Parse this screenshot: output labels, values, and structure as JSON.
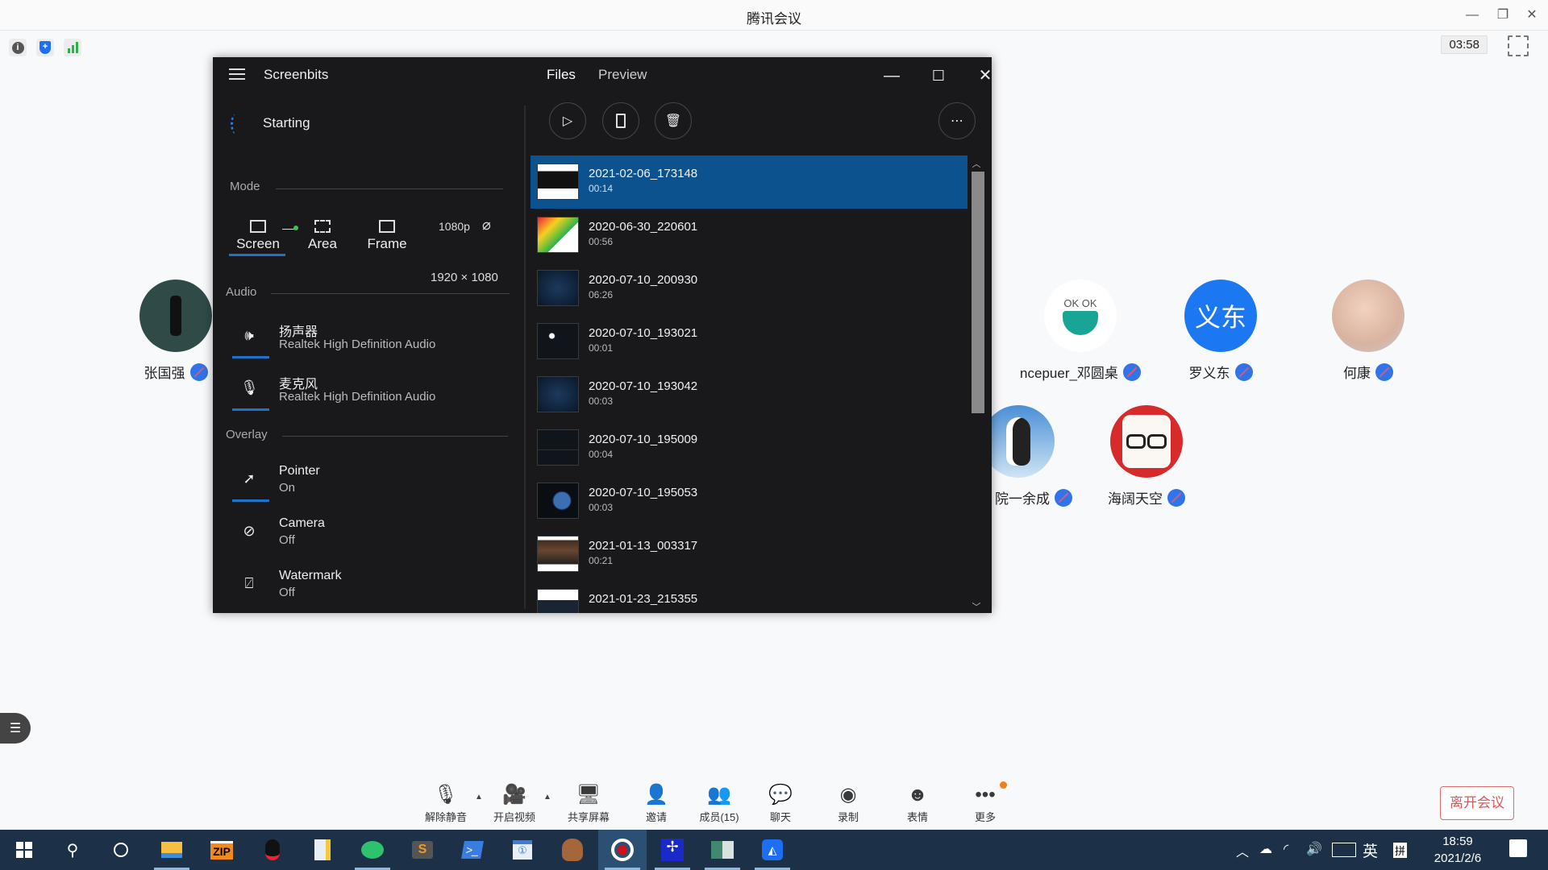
{
  "app": {
    "title": "腾讯会议",
    "timer": "03:58",
    "window_controls": [
      "minimize",
      "restore",
      "close"
    ],
    "top_icons": [
      "info-icon",
      "shield-icon",
      "signal-icon"
    ]
  },
  "screenbits": {
    "title": "Screenbits",
    "status": "Starting",
    "tabs": [
      "Files",
      "Preview"
    ],
    "quality": "1080p",
    "mode_label": "Mode",
    "modes": [
      {
        "label": "Screen",
        "icon": "monitor-icon",
        "selected": true
      },
      {
        "label": "Area",
        "icon": "area-icon",
        "selected": false
      },
      {
        "label": "Frame",
        "icon": "frame-icon",
        "selected": false
      }
    ],
    "dimensions": "1920 × 1080",
    "audio_label": "Audio",
    "audio": [
      {
        "title": "扬声器",
        "subtitle": "Realtek High Definition Audio",
        "icon": "speaker-icon",
        "enabled": true
      },
      {
        "title": "麦克风",
        "subtitle": "Realtek High Definition Audio",
        "icon": "microphone-icon",
        "enabled": true
      }
    ],
    "overlay_label": "Overlay",
    "overlay": [
      {
        "title": "Pointer",
        "subtitle": "On",
        "icon": "pointer-icon",
        "enabled": true
      },
      {
        "title": "Camera",
        "subtitle": "Off",
        "icon": "camera-off-icon",
        "enabled": false
      },
      {
        "title": "Watermark",
        "subtitle": "Off",
        "icon": "watermark-off-icon",
        "enabled": false
      }
    ],
    "actions": [
      "play-icon",
      "open-folder-icon",
      "delete-icon",
      "more-icon"
    ],
    "files": [
      {
        "name": "2021-02-06_173148",
        "duration": "00:14",
        "selected": true
      },
      {
        "name": "2020-06-30_220601",
        "duration": "00:56"
      },
      {
        "name": "2020-07-10_200930",
        "duration": "06:26"
      },
      {
        "name": "2020-07-10_193021",
        "duration": "00:01"
      },
      {
        "name": "2020-07-10_193042",
        "duration": "00:03"
      },
      {
        "name": "2020-07-10_195009",
        "duration": "00:04"
      },
      {
        "name": "2020-07-10_195053",
        "duration": "00:03"
      },
      {
        "name": "2021-01-13_003317",
        "duration": "00:21"
      },
      {
        "name": "2021-01-23_215355",
        "duration": ""
      }
    ]
  },
  "participants": [
    {
      "name": "张国强",
      "avatar": "photo",
      "muted": true
    },
    {
      "name": "ncepuer_邓圆桌",
      "avatar": "OK OK",
      "muted": true
    },
    {
      "name": "罗义东",
      "avatar": "义东",
      "muted": true
    },
    {
      "name": "何康",
      "avatar": "photo",
      "muted": true
    },
    {
      "name": "院一余成",
      "avatar": "penguin",
      "muted": true
    },
    {
      "name": "海阔天空",
      "avatar": "cartoon",
      "muted": true
    }
  ],
  "toolbar": {
    "items": [
      {
        "label": "解除静音",
        "icon": "mic-muted-icon"
      },
      {
        "label": "开启视频",
        "icon": "video-off-icon"
      },
      {
        "label": "共享屏幕",
        "icon": "share-screen-icon"
      },
      {
        "label": "邀请",
        "icon": "invite-icon"
      },
      {
        "label": "成员(15)",
        "icon": "members-icon"
      },
      {
        "label": "聊天",
        "icon": "chat-icon"
      },
      {
        "label": "录制",
        "icon": "record-icon"
      },
      {
        "label": "表情",
        "icon": "emoji-icon"
      },
      {
        "label": "更多",
        "icon": "more-icon"
      }
    ],
    "leave_label": "离开会议",
    "leave_color": "#e05555"
  },
  "taskbar": {
    "time": "18:59",
    "date": "2021/2/6",
    "ime": "英",
    "ime_mode": "拼"
  }
}
